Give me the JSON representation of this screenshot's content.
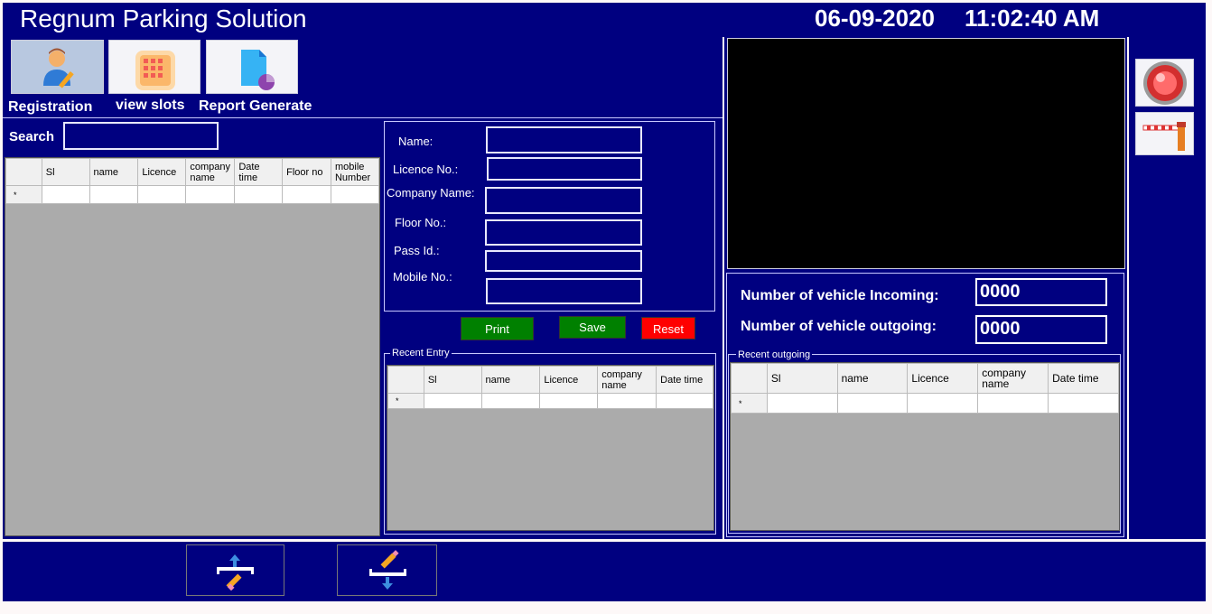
{
  "app": {
    "title": "Regnum Parking Solution",
    "date": "06-09-2020",
    "time": "11:02:40 AM"
  },
  "toolbar": {
    "registration_label": "Registration",
    "view_slots_label": "view slots",
    "report_label": "Report Generate"
  },
  "search": {
    "label": "Search",
    "value": ""
  },
  "main_table": {
    "columns": [
      "Sl",
      "name",
      "Licence",
      "company name",
      "Date time",
      "Floor no",
      "mobile Number"
    ],
    "new_row_marker": "*"
  },
  "form": {
    "name_label": "Name:",
    "licence_label": "Licence No.:",
    "company_label": "Company Name:",
    "floor_label": "Floor No.:",
    "pass_label": "Pass Id.:",
    "mobile_label": "Mobile No.:"
  },
  "buttons": {
    "print": "Print",
    "save": "Save",
    "reset": "Reset"
  },
  "recent_entry": {
    "legend": "Recent Entry",
    "columns": [
      "Sl",
      "name",
      "Licence",
      "company name",
      "Date time"
    ],
    "new_row_marker": "*"
  },
  "counters": {
    "incoming_label": "Number of vehicle  Incoming:",
    "incoming_value": "0000",
    "outgoing_label": "Number of vehicle  outgoing:",
    "outgoing_value": "0000"
  },
  "recent_outgoing": {
    "legend": "Recent outgoing",
    "columns": [
      "Sl",
      "name",
      "Licence",
      "company name",
      "Date time"
    ],
    "new_row_marker": "*"
  },
  "colors": {
    "navy": "#000080",
    "print_button": "#008000",
    "save_button": "#008000",
    "reset_button": "#ff0000",
    "grid_bg": "#ababab"
  },
  "icons": [
    "user-edit-icon",
    "grid-slots-icon",
    "report-document-icon",
    "alarm-light-icon",
    "barrier-gate-icon",
    "gate-open-icon",
    "gate-close-icon"
  ]
}
